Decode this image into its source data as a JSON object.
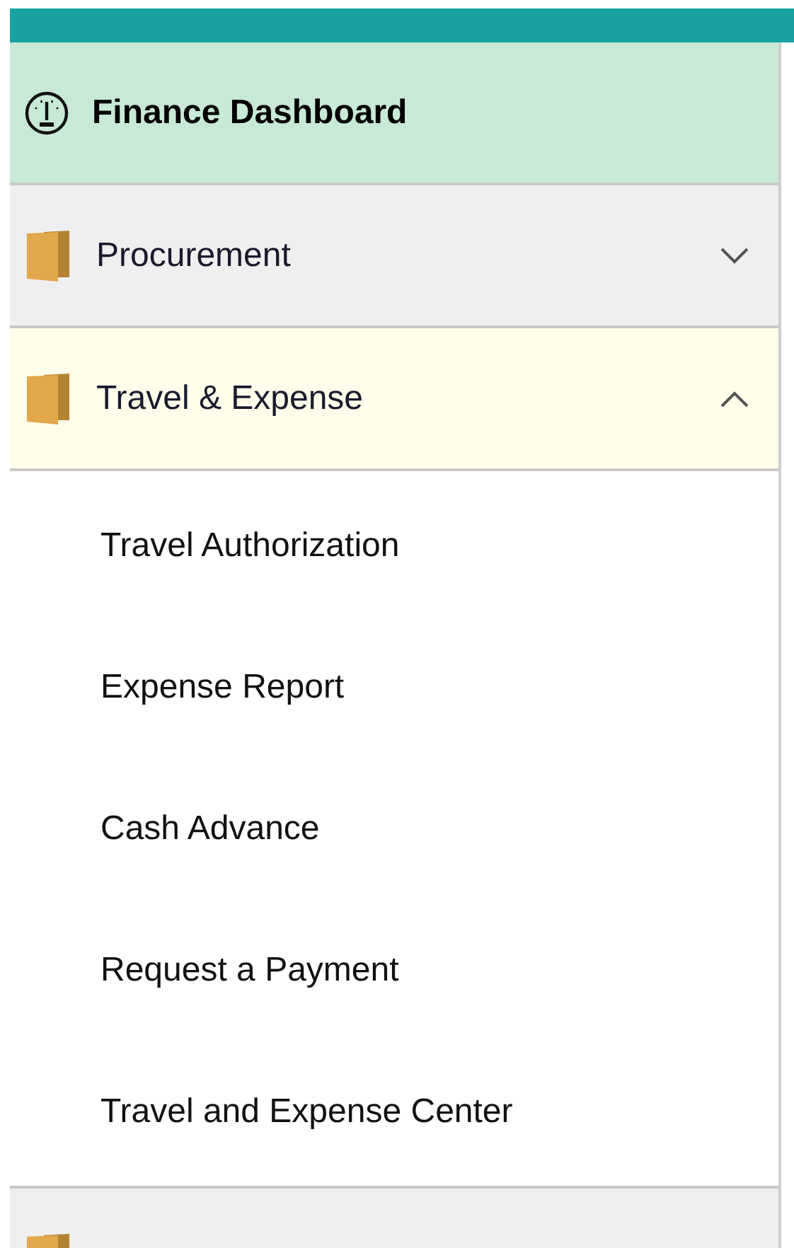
{
  "dashboard": {
    "label": "Finance Dashboard"
  },
  "menu": [
    {
      "label": "Procurement",
      "expanded": false
    },
    {
      "label": "Travel & Expense",
      "expanded": true,
      "children": [
        {
          "label": "Travel Authorization"
        },
        {
          "label": "Expense Report"
        },
        {
          "label": "Cash Advance"
        },
        {
          "label": "Request a Payment"
        },
        {
          "label": "Travel and Expense Center"
        }
      ]
    },
    {
      "expanded": false
    }
  ]
}
